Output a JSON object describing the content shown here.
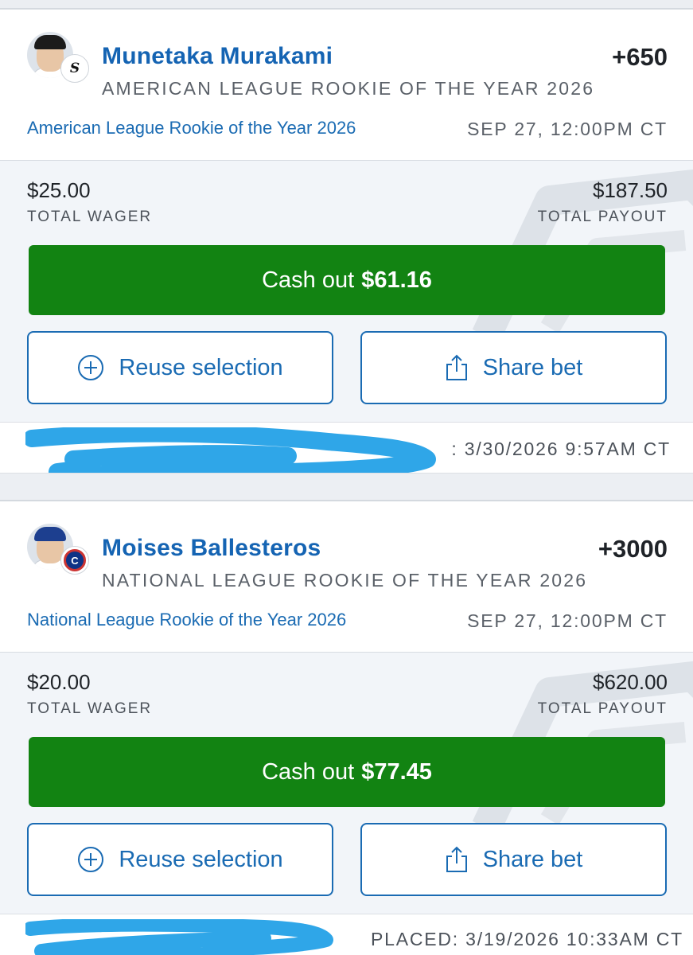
{
  "bets": [
    {
      "player": "Munetaka Murakami",
      "team_icon": "white-sox-logo",
      "odds": "+650",
      "market": "AMERICAN LEAGUE ROOKIE OF THE YEAR 2026",
      "event": "American League Rookie of the Year 2026",
      "event_time": "SEP 27, 12:00PM CT",
      "wager": "$25.00",
      "wager_label": "TOTAL WAGER",
      "payout": "$187.50",
      "payout_label": "TOTAL PAYOUT",
      "cashout_prefix": "Cash out",
      "cashout_amount": "$61.16",
      "reuse_label": "Reuse selection",
      "share_label": "Share bet",
      "placed_text": ": 3/30/2026 9:57AM CT"
    },
    {
      "player": "Moises Ballesteros",
      "team_icon": "cubs-logo",
      "odds": "+3000",
      "market": "NATIONAL LEAGUE ROOKIE OF THE YEAR 2026",
      "event": "National League Rookie of the Year 2026",
      "event_time": "SEP 27, 12:00PM CT",
      "wager": "$20.00",
      "wager_label": "TOTAL WAGER",
      "payout": "$620.00",
      "payout_label": "TOTAL PAYOUT",
      "cashout_prefix": "Cash out",
      "cashout_amount": "$77.45",
      "reuse_label": "Reuse selection",
      "share_label": "Share bet",
      "placed_text": "PLACED: 3/19/2026 10:33AM CT"
    }
  ],
  "colors": {
    "link_blue": "#1a6bb3",
    "cashout_green": "#128312",
    "panel_bg": "#f2f5f9",
    "redaction_blue": "#2fa6e8"
  }
}
